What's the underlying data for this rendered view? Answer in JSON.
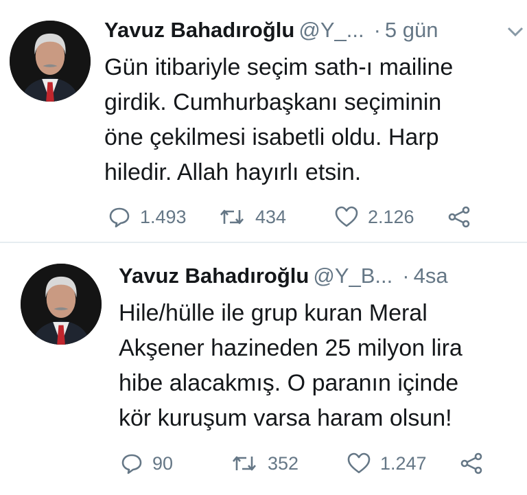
{
  "tweets": [
    {
      "author": "Yavuz Bahadıroğlu",
      "handle": "@Y_...",
      "separator": "·",
      "time": "5 gün",
      "text": "Gün itibariyle seçim sath-ı mailine\ngirdik. Cumhurbaşkanı seçiminin\nöne çekilmesi isabetli oldu. Harp\nhiledir. Allah hayırlı etsin.",
      "replies": "1.493",
      "retweets": "434",
      "likes": "2.126"
    },
    {
      "author": "Yavuz Bahadıroğlu",
      "handle": "@Y_B...",
      "separator": "·",
      "time": "4sa",
      "text": "Hile/hülle ile grup kuran Meral\nAkşener hazineden 25 milyon lira\nhibe alacakmış. O paranın içinde\nkör kuruşum varsa haram olsun!",
      "replies": "90",
      "retweets": "352",
      "likes": "1.247"
    }
  ],
  "colors": {
    "text": "#14171a",
    "secondary": "#657786",
    "divider": "#e6ecf0"
  },
  "icons": [
    "reply-icon",
    "retweet-icon",
    "like-icon",
    "share-icon",
    "chevron-down-icon"
  ]
}
